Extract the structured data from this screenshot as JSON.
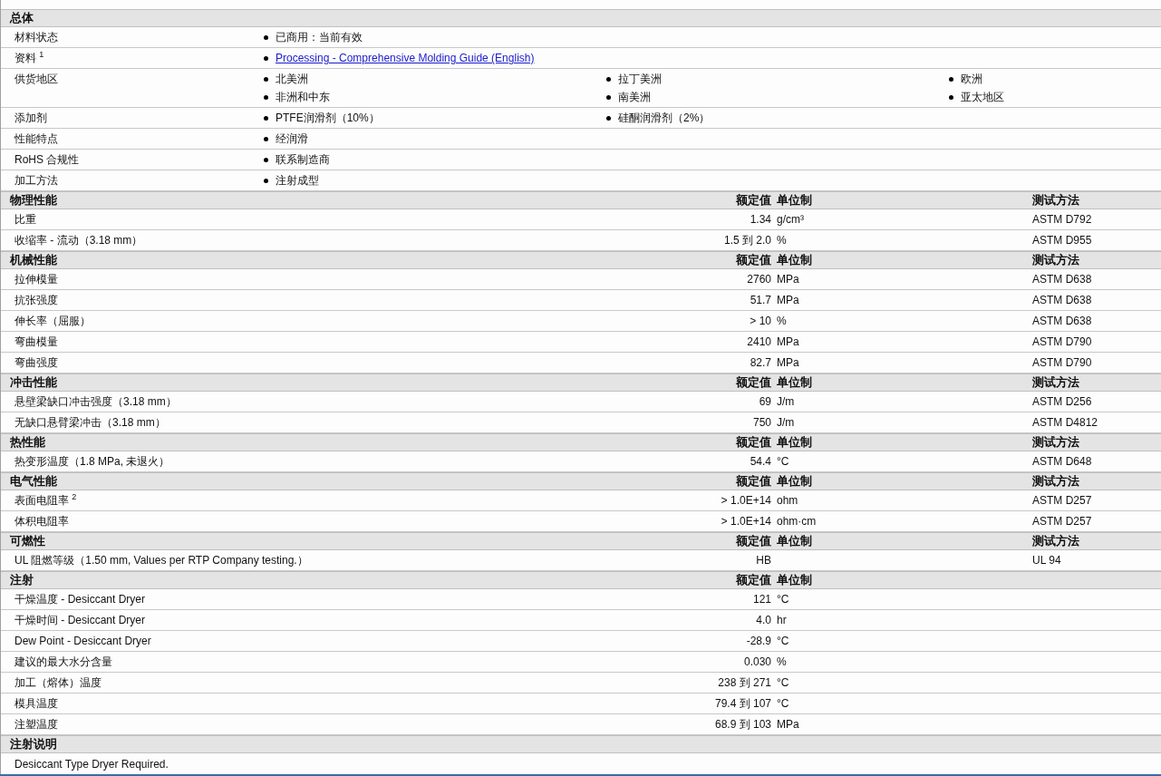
{
  "general": {
    "title": "总体",
    "rows": [
      {
        "label": "材料状态",
        "values": [
          {
            "kind": "text",
            "text": "已商用：当前有效"
          }
        ]
      },
      {
        "label": "资料 $^{1}$",
        "values": [
          {
            "kind": "link",
            "text": "Processing - Comprehensive Molding Guide (English)"
          }
        ]
      },
      {
        "label": "供货地区",
        "values": [
          {
            "kind": "text",
            "text": "北美洲"
          },
          {
            "kind": "text",
            "text": "拉丁美洲"
          },
          {
            "kind": "text",
            "text": "欧洲"
          },
          {
            "kind": "text",
            "text": "非洲和中东"
          },
          {
            "kind": "text",
            "text": "南美洲"
          },
          {
            "kind": "text",
            "text": "亚太地区"
          }
        ]
      },
      {
        "label": "添加剂",
        "values": [
          {
            "kind": "text",
            "text": "PTFE润滑剂（10%）"
          },
          {
            "kind": "text",
            "text": "硅酮润滑剂（2%）"
          }
        ]
      },
      {
        "label": "性能特点",
        "values": [
          {
            "kind": "text",
            "text": "经润滑"
          }
        ]
      },
      {
        "label": "RoHS 合规性",
        "values": [
          {
            "kind": "text",
            "text": "联系制造商"
          }
        ]
      },
      {
        "label": "加工方法",
        "values": [
          {
            "kind": "text",
            "text": "注射成型"
          }
        ]
      }
    ]
  },
  "sections": [
    {
      "title": "物理性能",
      "headers": [
        "额定值",
        "单位制",
        "测试方法"
      ],
      "rows": [
        {
          "property": "比重",
          "value": "1.34",
          "unit": "g/cm³",
          "test_method": "ASTM D792"
        },
        {
          "property": "收缩率 - 流动（3.18 mm）",
          "value": "1.5 到 2.0",
          "unit": "%",
          "test_method": "ASTM D955"
        }
      ]
    },
    {
      "title": "机械性能",
      "headers": [
        "额定值",
        "单位制",
        "测试方法"
      ],
      "rows": [
        {
          "property": "拉伸模量",
          "value": "2760",
          "unit": "MPa",
          "test_method": "ASTM D638"
        },
        {
          "property": "抗张强度",
          "value": "51.7",
          "unit": "MPa",
          "test_method": "ASTM D638"
        },
        {
          "property": "伸长率（屈服）",
          "value": "> 10",
          "unit": "%",
          "test_method": "ASTM D638"
        },
        {
          "property": "弯曲模量",
          "value": "2410",
          "unit": "MPa",
          "test_method": "ASTM D790"
        },
        {
          "property": "弯曲强度",
          "value": "82.7",
          "unit": "MPa",
          "test_method": "ASTM D790"
        }
      ]
    },
    {
      "title": "冲击性能",
      "headers": [
        "额定值",
        "单位制",
        "测试方法"
      ],
      "rows": [
        {
          "property": "悬壁梁缺口冲击强度（3.18 mm）",
          "value": "69",
          "unit": "J/m",
          "test_method": "ASTM D256"
        },
        {
          "property": "无缺口悬臂梁冲击（3.18 mm）",
          "value": "750",
          "unit": "J/m",
          "test_method": "ASTM D4812"
        }
      ]
    },
    {
      "title": "热性能",
      "headers": [
        "额定值",
        "单位制",
        "测试方法"
      ],
      "rows": [
        {
          "property": "热变形温度（1.8 MPa, 未退火）",
          "value": "54.4",
          "unit": "°C",
          "test_method": "ASTM D648"
        }
      ]
    },
    {
      "title": "电气性能",
      "headers": [
        "额定值",
        "单位制",
        "测试方法"
      ],
      "rows": [
        {
          "property": "表面电阻率 $^{2}$",
          "value": "> 1.0E+14",
          "unit": "ohm",
          "test_method": "ASTM D257"
        },
        {
          "property": "体积电阻率",
          "value": "> 1.0E+14",
          "unit": "ohm·cm",
          "test_method": "ASTM D257"
        }
      ]
    },
    {
      "title": "可燃性",
      "headers": [
        "额定值",
        "单位制",
        "测试方法"
      ],
      "rows": [
        {
          "property": "UL 阻燃等级（1.50 mm, Values per RTP Company testing.）",
          "value": "HB",
          "test_method": "UL 94"
        }
      ]
    },
    {
      "title": "注射",
      "headers": [
        "额定值",
        "单位制"
      ],
      "rows": [
        {
          "property": "干燥温度 - Desiccant Dryer",
          "value": "121",
          "unit": "°C"
        },
        {
          "property": "干燥时间 - Desiccant Dryer",
          "value": "4.0",
          "unit": "hr"
        },
        {
          "property": "Dew Point - Desiccant Dryer",
          "value": "-28.9",
          "unit": "°C"
        },
        {
          "property": "建议的最大水分含量",
          "value": "0.030",
          "unit": "%"
        },
        {
          "property": "加工（熔体）温度",
          "value": "238 到 271",
          "unit": "°C"
        },
        {
          "property": "模具温度",
          "value": "79.4 到 107",
          "unit": "°C"
        },
        {
          "property": "注塑温度",
          "value": "68.9 到 103",
          "unit": "MPa"
        }
      ]
    },
    {
      "title": "注射说明",
      "notes": [
        "Desiccant Type Dryer Required."
      ]
    }
  ]
}
